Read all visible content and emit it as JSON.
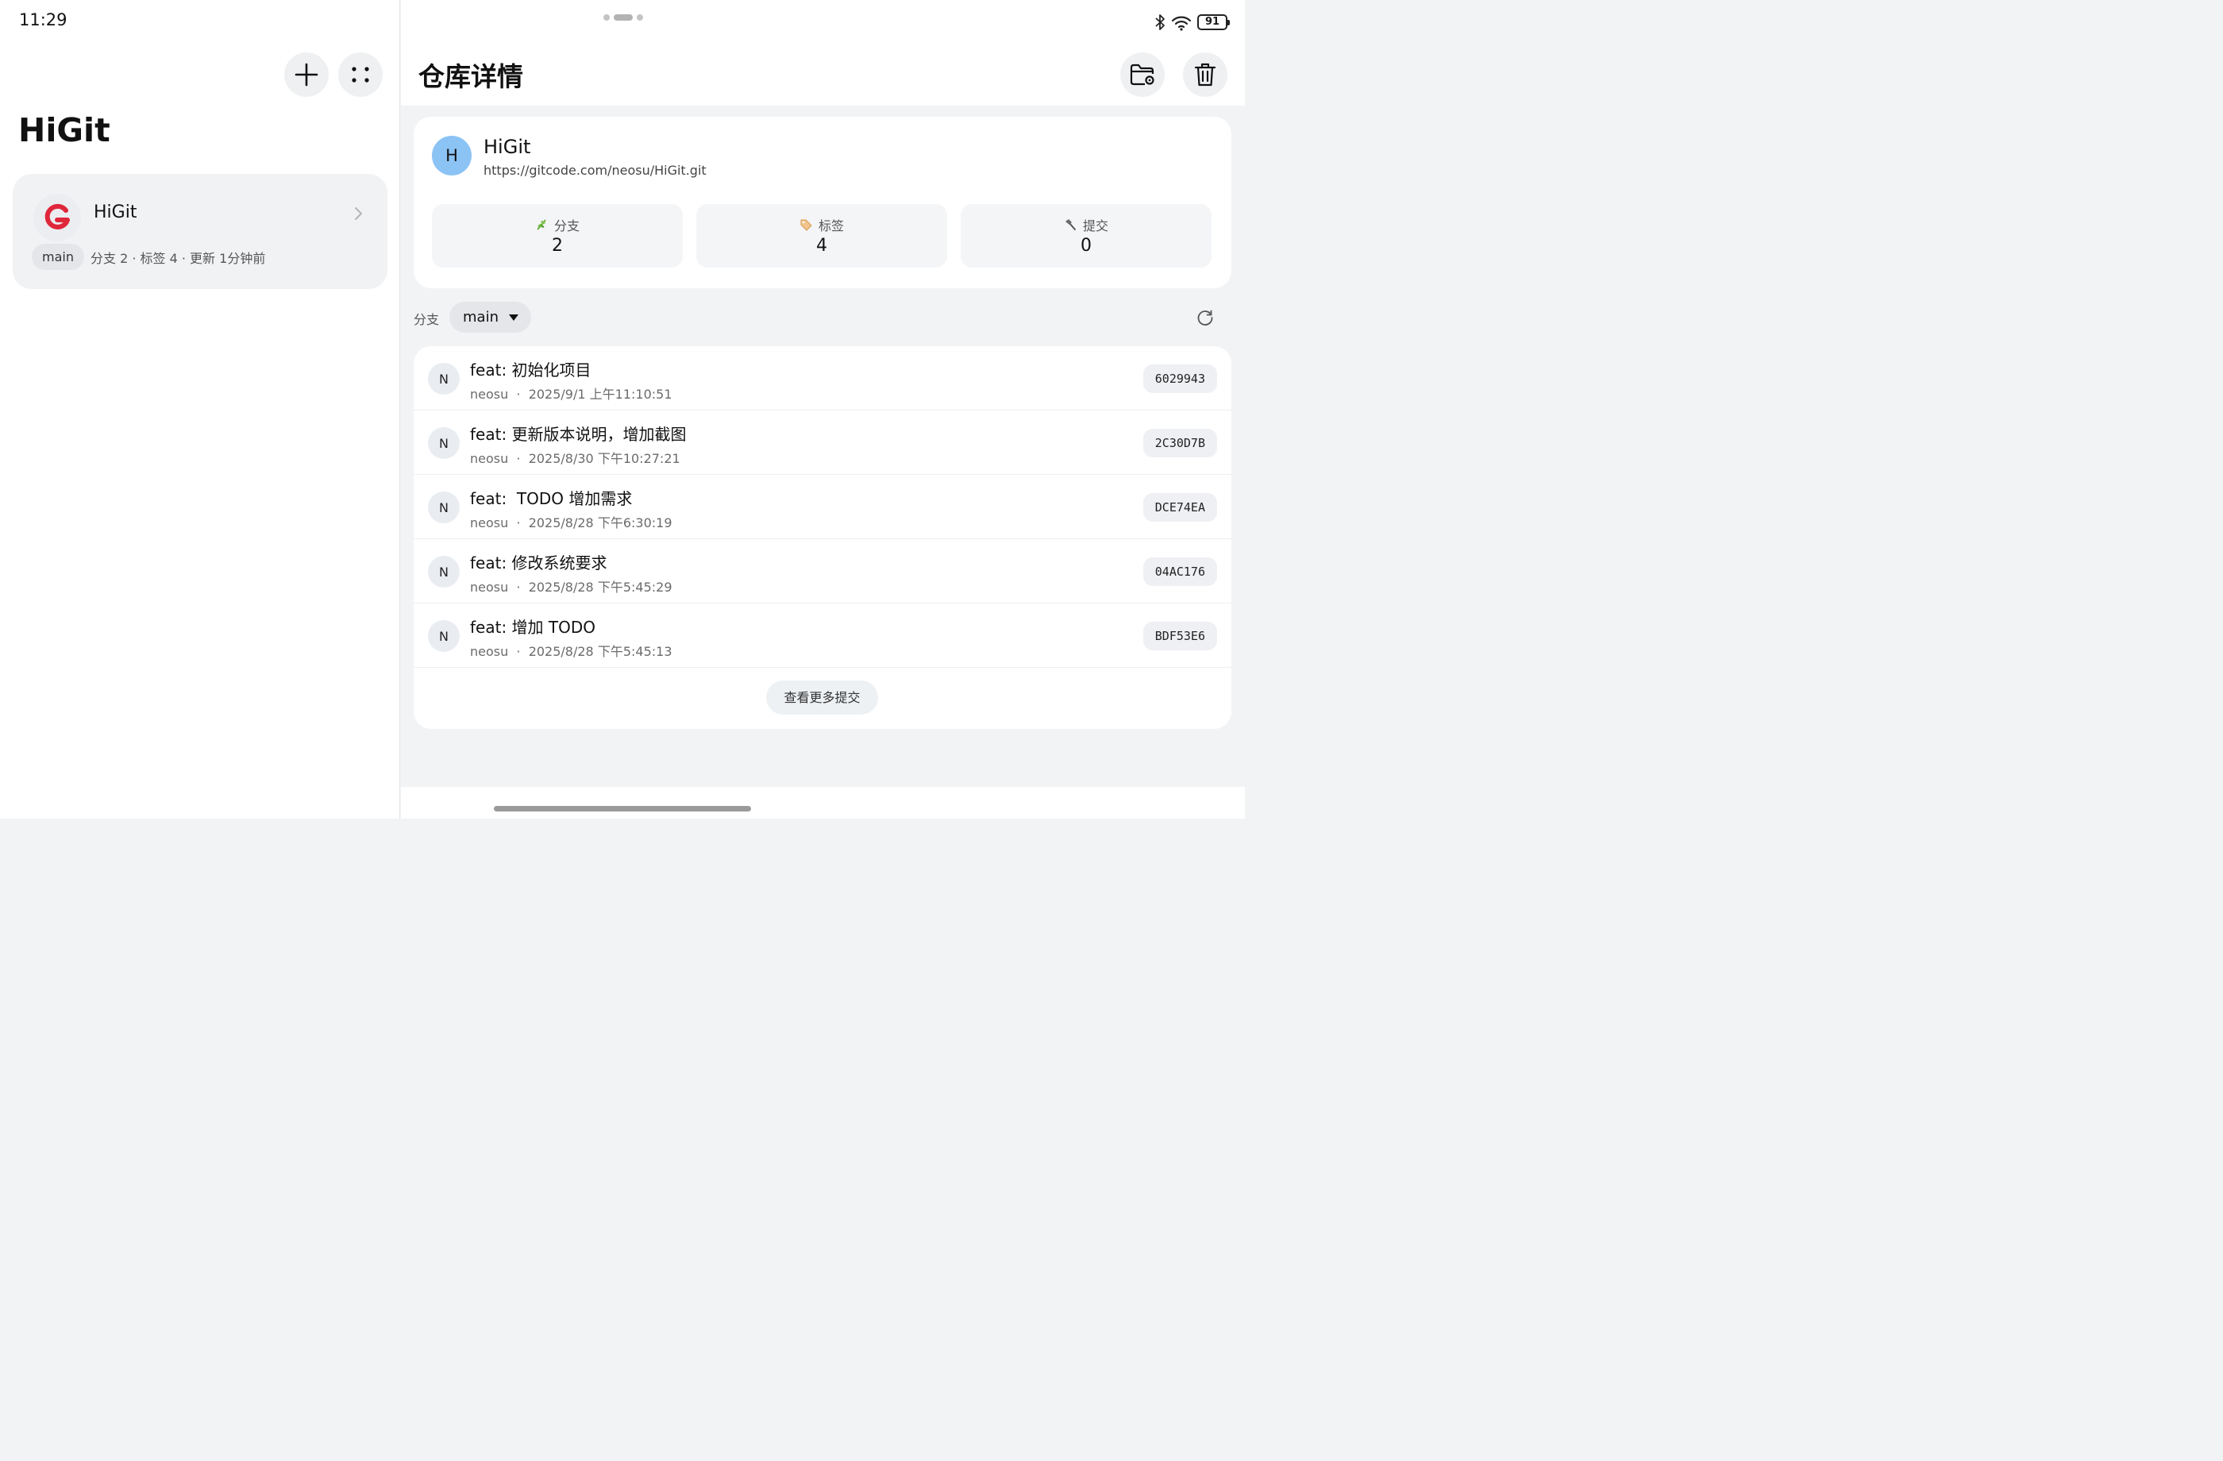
{
  "status_bar": {
    "time": "11:29",
    "battery": "91"
  },
  "left": {
    "title": "HiGit",
    "repo_card": {
      "name": "HiGit",
      "branch": "main",
      "meta": "分支 2 · 标签 4 · 更新 1分钟前"
    }
  },
  "detail": {
    "title": "仓库详情",
    "repo": {
      "avatar_letter": "H",
      "name": "HiGit",
      "url": "https://gitcode.com/neosu/HiGit.git"
    },
    "stats": {
      "branches": {
        "label": "分支",
        "value": "2",
        "icon": "herb-icon"
      },
      "tags": {
        "label": "标签",
        "value": "4",
        "icon": "tag-icon"
      },
      "commits": {
        "label": "提交",
        "value": "0",
        "icon": "hammer-icon"
      }
    },
    "branch_label": "分支",
    "branch_selected": "main",
    "commits": [
      {
        "avatar": "N",
        "message": "feat: 初始化项目",
        "author": "neosu",
        "sep": "·",
        "date": "2025/9/1 上午11:10:51",
        "hash": "6029943"
      },
      {
        "avatar": "N",
        "message": "feat: 更新版本说明，增加截图",
        "author": "neosu",
        "sep": "·",
        "date": "2025/8/30 下午10:27:21",
        "hash": "2C30D7B"
      },
      {
        "avatar": "N",
        "message": "feat:  TODO 增加需求",
        "author": "neosu",
        "sep": "·",
        "date": "2025/8/28 下午6:30:19",
        "hash": "DCE74EA"
      },
      {
        "avatar": "N",
        "message": "feat: 修改系统要求",
        "author": "neosu",
        "sep": "·",
        "date": "2025/8/28 下午5:45:29",
        "hash": "04AC176"
      },
      {
        "avatar": "N",
        "message": "feat: 增加 TODO",
        "author": "neosu",
        "sep": "·",
        "date": "2025/8/28 下午5:45:13",
        "hash": "BDF53E6"
      }
    ],
    "more_commits": "查看更多提交"
  },
  "colors": {
    "logo_red": "#e0263a",
    "avatar_blue": "#8cc3f5"
  }
}
